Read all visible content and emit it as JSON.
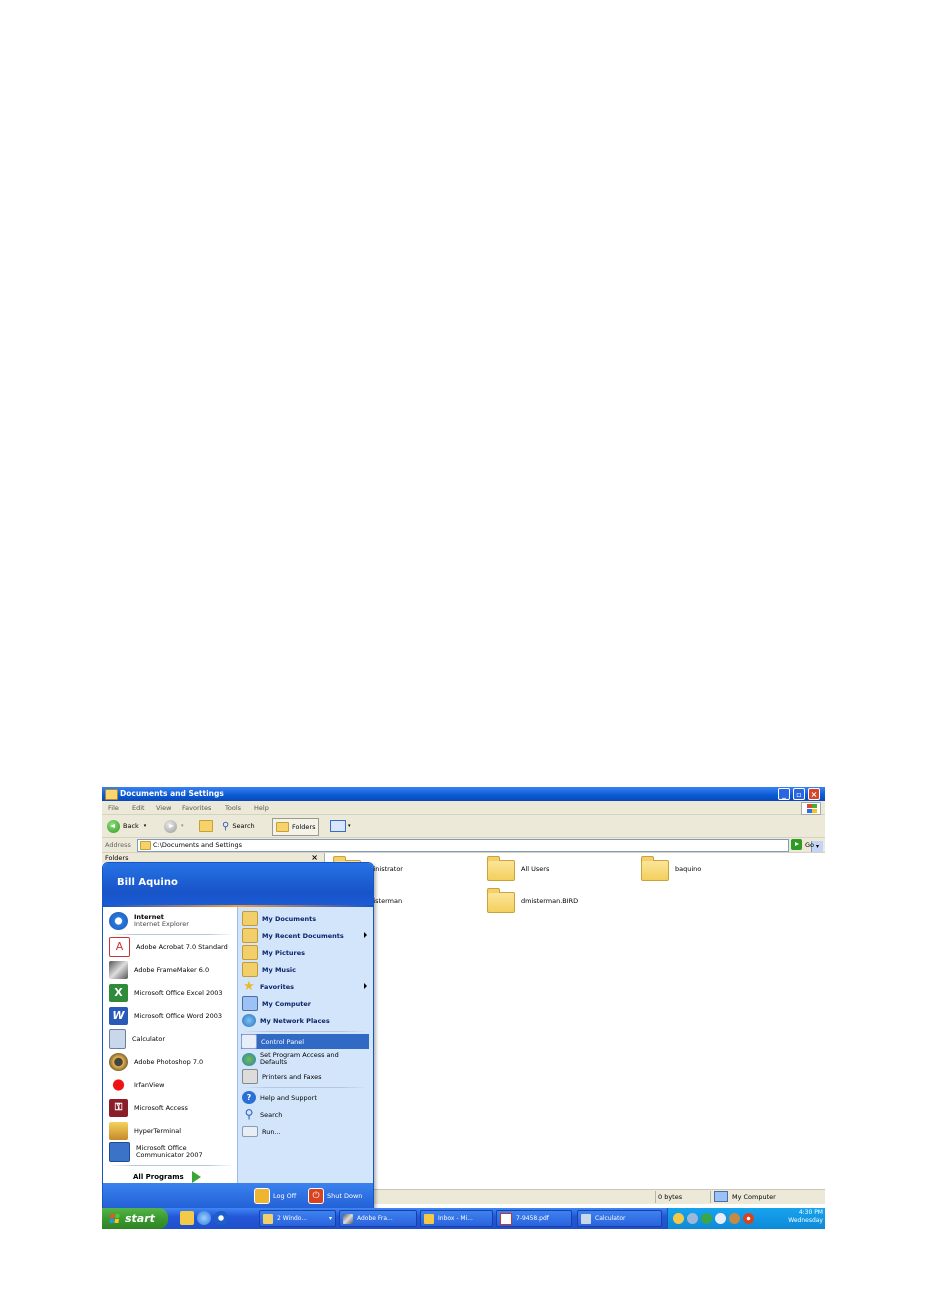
{
  "window": {
    "title": "Documents and Settings",
    "menu": [
      "File",
      "Edit",
      "View",
      "Favorites",
      "Tools",
      "Help"
    ],
    "toolbar": {
      "back": "Back",
      "search": "Search",
      "folders": "Folders"
    },
    "address": {
      "label": "Address",
      "value": "C:\\Documents and Settings",
      "go": "Go"
    },
    "folders_pane": {
      "title": "Folders",
      "close": "×"
    },
    "items": [
      {
        "name": "dministrator"
      },
      {
        "name": "All Users"
      },
      {
        "name": "baquino"
      },
      {
        "name": "misterman"
      },
      {
        "name": "dmisterman.BIRD"
      }
    ],
    "status": {
      "size": "0 bytes",
      "location": "My Computer"
    }
  },
  "start_menu": {
    "user": "Bill Aquino",
    "pinned": [
      {
        "title": "Internet",
        "subtitle": "Internet Explorer",
        "icon": "internet-explorer-icon"
      }
    ],
    "recent": [
      {
        "label": "Adobe Acrobat 7.0 Standard",
        "icon": "acrobat-icon"
      },
      {
        "label": "Adobe FrameMaker 6.0",
        "icon": "framemaker-icon"
      },
      {
        "label": "Microsoft Office Excel 2003",
        "icon": "excel-icon"
      },
      {
        "label": "Microsoft Office Word 2003",
        "icon": "word-icon"
      },
      {
        "label": "Calculator",
        "icon": "calculator-icon"
      },
      {
        "label": "Adobe Photoshop 7.0",
        "icon": "photoshop-icon"
      },
      {
        "label": "IrfanView",
        "icon": "irfanview-icon"
      },
      {
        "label": "Microsoft Access",
        "icon": "access-icon"
      },
      {
        "label": "HyperTerminal",
        "icon": "hyperterminal-icon"
      },
      {
        "label": "Microsoft Office Communicator 2007",
        "icon": "communicator-icon"
      }
    ],
    "all_programs": "All Programs",
    "places": [
      {
        "label": "My Documents"
      },
      {
        "label": "My Recent Documents"
      },
      {
        "label": "My Pictures"
      },
      {
        "label": "My Music"
      },
      {
        "label": "Favorites"
      },
      {
        "label": "My Computer"
      },
      {
        "label": "My Network Places"
      }
    ],
    "system": [
      {
        "label": "Control Panel"
      },
      {
        "label": "Set Program Access and Defaults"
      },
      {
        "label": "Printers and Faxes"
      }
    ],
    "help": [
      {
        "label": "Help and Support"
      },
      {
        "label": "Search"
      },
      {
        "label": "Run..."
      }
    ],
    "log_off": "Log Off",
    "shut_down": "Shut Down"
  },
  "taskbar": {
    "start": "start",
    "tasks": [
      {
        "label": "2 Windo..."
      },
      {
        "label": "Adobe Fra..."
      },
      {
        "label": "Inbox - Mi..."
      },
      {
        "label": "7-9458.pdf"
      },
      {
        "label": "Calculator"
      }
    ],
    "clock": {
      "time": "4:30 PM",
      "day": "Wednesday"
    }
  },
  "colors": {
    "xp_blue": "#0a5ad4",
    "start_green": "#3b9a2f",
    "highlight": "#316ac5",
    "tray": "#0e8ad8"
  }
}
